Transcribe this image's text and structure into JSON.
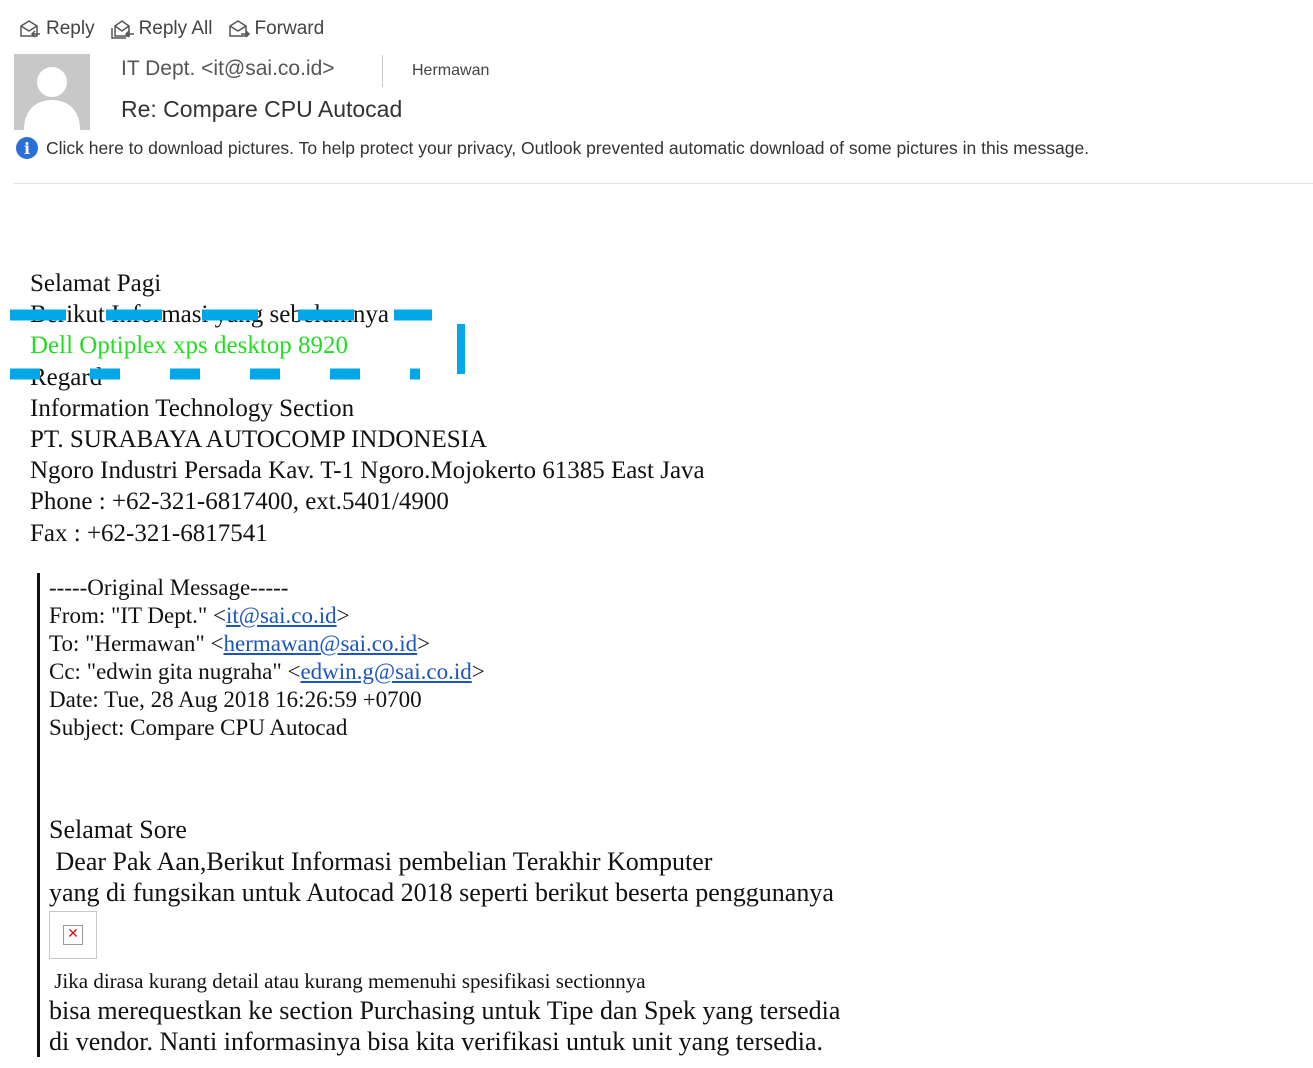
{
  "toolbar": {
    "reply": "Reply",
    "reply_all": "Reply All",
    "forward": "Forward"
  },
  "header": {
    "sender": "IT Dept. <it@sai.co.id>",
    "recipient": "Hermawan",
    "subject": "Re: Compare CPU Autocad"
  },
  "infobar": {
    "icon": "info-icon",
    "text": "Click here to download pictures. To help protect your privacy, Outlook prevented automatic download of some pictures in this message."
  },
  "body": {
    "greeting": "Selamat Pagi",
    "line2": "Berikut Informasi yang sebelumnya",
    "product": "Dell Optiplex xps desktop 8920",
    "regard": "Regard",
    "sig_section": "Information Technology Section",
    "sig_company": "PT. SURABAYA AUTOCOMP INDONESIA",
    "sig_address": "Ngoro Industri Persada Kav. T-1 Ngoro.Mojokerto 61385 East Java",
    "sig_phone": "Phone : +62-321-6817400, ext.5401/4900",
    "sig_fax": "Fax : +62-321-6817541",
    "highlight_color": "#22dd22"
  },
  "quoted": {
    "original_marker": "-----Original Message-----",
    "from_prefix": "From: \"IT Dept.\" <",
    "from_email": "it@sai.co.id",
    "to_prefix": "To: \"Hermawan\" <",
    "to_email": "hermawan@sai.co.id",
    "cc_prefix": "Cc: \"edwin gita nugraha\" <",
    "cc_email": "edwin.g@sai.co.id",
    "close": ">",
    "date": "Date: Tue, 28 Aug 2018 16:26:59 +0700",
    "subject": "Subject: Compare CPU Autocad",
    "greeting": "Selamat Sore",
    "line1": " Dear Pak Aan,Berikut Informasi pembelian Terakhir Komputer",
    "line2": "yang di fungsikan untuk Autocad 2018 seperti berikut beserta penggunanya",
    "broken_image_icon": "broken-image-icon",
    "line3": " Jika dirasa kurang detail atau kurang memenuhi spesifikasi sectionnya",
    "line4": "bisa merequestkan ke section Purchasing untuk Tipe dan Spek yang tersedia",
    "line5": "di vendor. Nanti informasinya bisa kita verifikasi untuk unit yang tersedia."
  },
  "colors": {
    "annotation_dash": "#00a8e8",
    "link": "#1a55c0"
  }
}
